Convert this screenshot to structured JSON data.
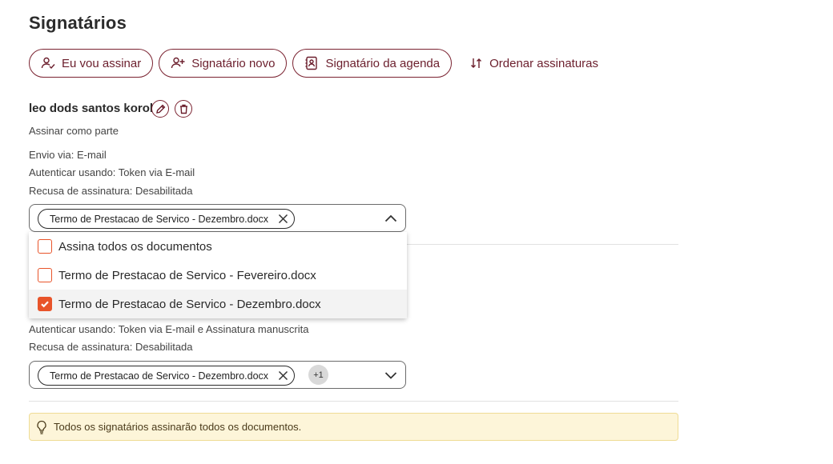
{
  "page_title": "Signatários",
  "actions": {
    "eu_vou_assinar": "Eu vou assinar",
    "signatario_novo": "Signatário novo",
    "signatario_agenda": "Signatário da agenda",
    "ordenar": "Ordenar assinaturas"
  },
  "signer1": {
    "name": "leo dods santos korol",
    "role": "Assinar como parte",
    "envio": "Envio via:  E-mail",
    "autenticar": "Autenticar usando:  Token via E-mail",
    "recusa": "Recusa de assinatura:  Desabilitada",
    "selected_doc": "Termo de Prestacao de Servico - Dezembro.docx"
  },
  "dropdown": {
    "options": [
      {
        "label": "Assina todos os documentos",
        "checked": false
      },
      {
        "label": "Termo de Prestacao de Servico - Fevereiro.docx",
        "checked": false
      },
      {
        "label": "Termo de Prestacao de Servico - Dezembro.docx",
        "checked": true
      }
    ]
  },
  "signer2": {
    "autenticar": "Autenticar usando:  Token via E-mail e Assinatura manuscrita",
    "recusa": "Recusa de assinatura:  Desabilitada",
    "selected_doc": "Termo de Prestacao de Servico - Dezembro.docx",
    "more_count": "+1"
  },
  "info_message": "Todos os signatários assinarão todos os documentos.",
  "colors": {
    "brand": "#6b1e2c",
    "checkbox": "#e8542a",
    "info_bg": "#fdf5d9"
  }
}
